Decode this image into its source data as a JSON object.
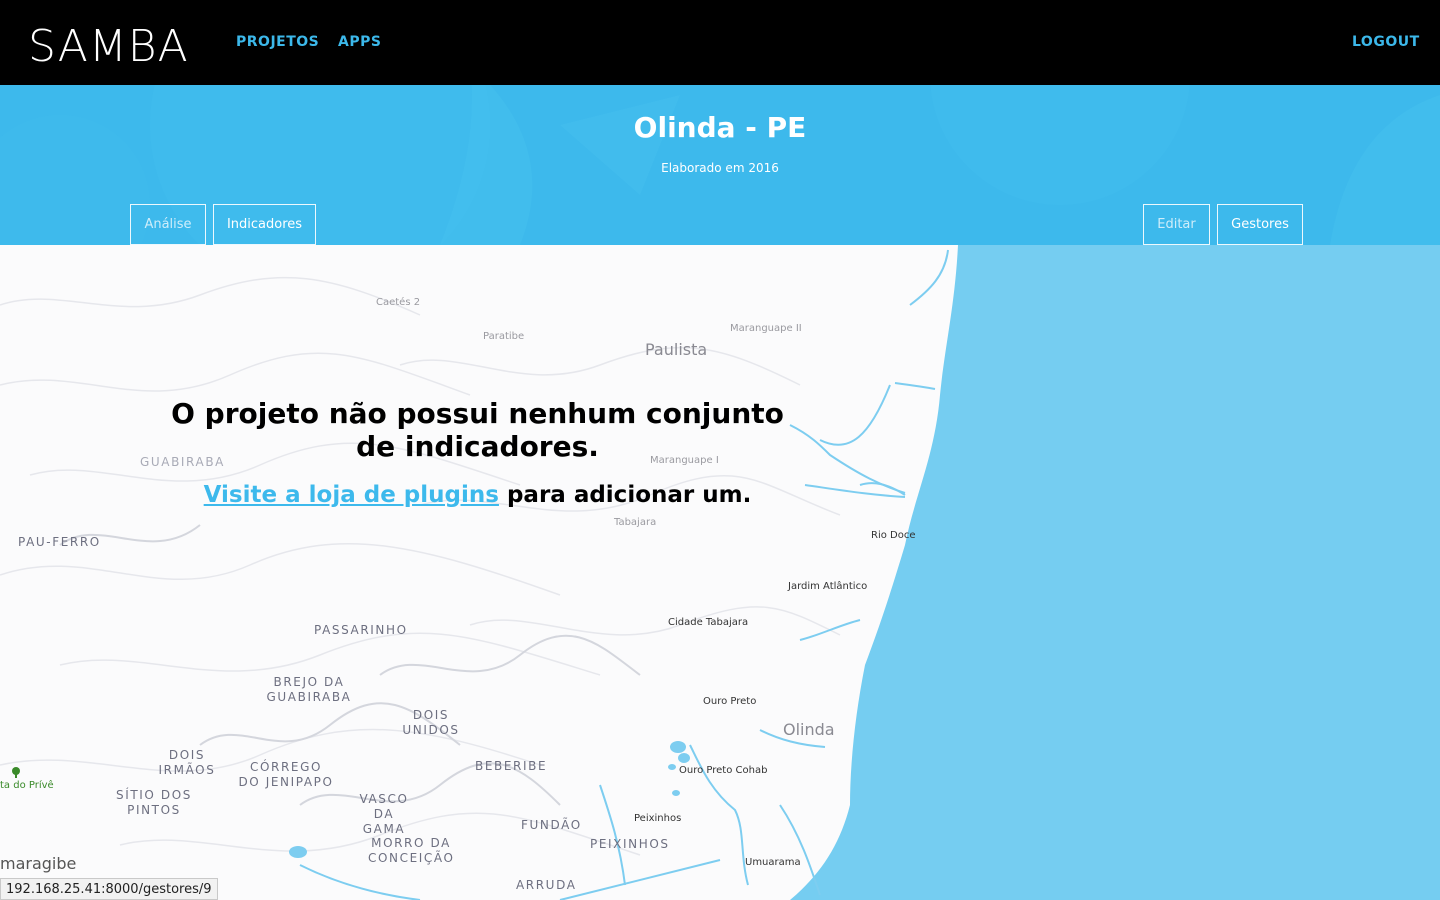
{
  "nav": {
    "logo": "SAMBA",
    "projects": "PROJETOS",
    "apps": "APPS",
    "logout": "LOGOUT"
  },
  "project": {
    "title": "Olinda - PE",
    "subtitle": "Elaborado em 2016"
  },
  "tabs": {
    "analysis": "Análise",
    "indicators": "Indicadores",
    "edit": "Editar",
    "managers": "Gestores"
  },
  "message": {
    "line1": "O projeto não possui nenhum conjunto de indicadores.",
    "link": "Visite a loja de plugins",
    "rest": " para adicionar um."
  },
  "map_labels": {
    "caetes": "Caetés 2",
    "paratibe": "Paratibe",
    "maranguape2": "Maranguape II",
    "paulista": "Paulista",
    "guabiraba": "GUABIRABA",
    "maranguape1": "Maranguape I",
    "tabajara": "Tabajara",
    "pau_ferro": "PAU-FERRO",
    "rio_doce": "Rio Doce",
    "jardim": "Jardim Atlântico",
    "cidade_tabajara": "Cidade Tabajara",
    "passarinho": "PASSARINHO",
    "brejo": "BREJO DA GUABIRABA",
    "ouro_preto": "Ouro Preto",
    "olinda": "Olinda",
    "dois_unidos": "DOIS UNIDOS",
    "dois_irmaos": "DOIS IRMÃOS",
    "corrego": "CÓRREGO DO JENIPAPO",
    "beberibe": "BEBERIBE",
    "ouro_preto_cohab": "Ouro Preto Cohab",
    "mata": "ta do Prívê",
    "sitio": "SÍTIO DOS PINTOS",
    "vasco": "VASCO DA GAMA",
    "fundao": "FUNDÃO",
    "peixinhos": "Peixinhos",
    "morro": "MORRO DA CONCEIÇÃO",
    "peixinhos_caps": "PEIXINHOS",
    "umuarama": "Umuarama",
    "camaragibe": "maragibe",
    "arruda": "ARRUDA"
  },
  "status_url": "192.168.25.41:8000/gestores/9",
  "colors": {
    "brand_blue": "#3db9ec",
    "sea": "#75cdf1",
    "nav_bg": "#000000"
  }
}
